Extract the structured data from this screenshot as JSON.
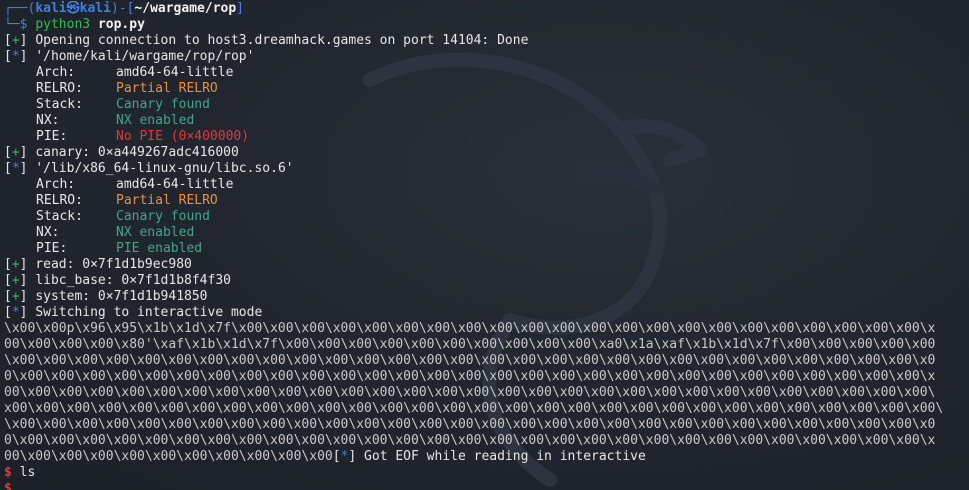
{
  "prompt": {
    "user_host": "kali㉿kali",
    "path": "~/wargame/rop",
    "command_name": "python3",
    "command_arg": "rop.py"
  },
  "log": {
    "opening": "Opening connection to host3.dreamhack.games on port 14104: Done",
    "binary_path": "'/home/kali/wargame/rop/rop'",
    "canary": "canary: 0×a449267adc416000",
    "libc_path": "'/lib/x86_64-linux-gnu/libc.so.6'",
    "read": "read: 0×7f1d1b9ec980",
    "libc_base": "libc_base: 0×7f1d1b8f4f30",
    "system": "system: 0×7f1d1b941850",
    "interactive": "Switching to interactive mode",
    "eof": "Got EOF while reading in interactive"
  },
  "checksec_rop": {
    "arch_key": "Arch:",
    "arch_val": "amd64-64-little",
    "relro_key": "RELRO:",
    "relro_val": "Partial RELRO",
    "stack_key": "Stack:",
    "stack_val": "Canary found",
    "nx_key": "NX:",
    "nx_val": "NX enabled",
    "pie_key": "PIE:",
    "pie_val": "No PIE (0×400000)"
  },
  "checksec_libc": {
    "arch_key": "Arch:",
    "arch_val": "amd64-64-little",
    "relro_key": "RELRO:",
    "relro_val": "Partial RELRO",
    "stack_key": "Stack:",
    "stack_val": "Canary found",
    "nx_key": "NX:",
    "nx_val": "NX enabled",
    "pie_key": "PIE:",
    "pie_val": "PIE enabled"
  },
  "markers": {
    "plus": "+",
    "star": "*",
    "open": "[",
    "close": "]"
  },
  "dump": {
    "line1": "\\x00\\x00p\\x96\\x95\\x1b\\x1d\\x7f\\x00\\x00\\x00\\x00\\x00\\x00\\x00\\x00\\x00\\x00\\x00\\x00\\x00\\x00\\x00\\x00\\x00\\x00\\x00\\x00\\x00\\x00\\x",
    "line2": "00\\x00\\x00\\x00\\x80'\\xaf\\x1b\\x1d\\x7f\\x00\\x00\\x00\\x00\\x00\\x00\\x00\\x00\\x00\\x00\\xa0\\x1a\\xaf\\x1b\\x1d\\x7f\\x00\\x00\\x00\\x00\\x00",
    "line3": "\\x00\\x00\\x00\\x00\\x00\\x00\\x00\\x00\\x00\\x00\\x00\\x00\\x00\\x00\\x00\\x00\\x00\\x00\\x00\\x00\\x00\\x00\\x00\\x00\\x00\\x00\\x00\\x00\\x00\\x0",
    "line4": "0\\x00\\x00\\x00\\x00\\x00\\x00\\x00\\x00\\x00\\x00\\x00\\x00\\x00\\x00\\x00\\x00\\x00\\x00\\x00\\x00\\x00\\x00\\x00\\x00\\x00\\x00\\x00\\x00\\x00\\x",
    "line5": "00\\x00\\x00\\x00\\x00\\x00\\x00\\x00\\x00\\x00\\x00\\x00\\x00\\x00\\x00\\x00\\x00\\x00\\x00\\x00\\x00\\x00\\x00\\x00\\x00\\x00\\x00\\x00\\x00\\x00\\",
    "line6": "x00\\x00\\x00\\x00\\x00\\x00\\x00\\x00\\x00\\x00\\x00\\x00\\x00\\x00\\x00\\x00\\x00\\x00\\x00\\x00\\x00\\x00\\x00\\x00\\x00\\x00\\x00\\x00\\x00\\x00\\",
    "line7": "\\x00\\x00\\x00\\x00\\x00\\x00\\x00\\x00\\x00\\x00\\x00\\x00\\x00\\x00\\x00\\x00\\x00\\x00\\x00\\x00\\x00\\x00\\x00\\x00\\x00\\x00\\x00\\x00\\x00\\x0",
    "line8": "0\\x00\\x00\\x00\\x00\\x00\\x00\\x00\\x00\\x00\\x00\\x00\\x00\\x00\\x00\\x00\\x00\\x00\\x00\\x00\\x00\\x00\\x00\\x00\\x00\\x00\\x00\\x00\\x00\\x00\\x",
    "line9": "00\\x00\\x00\\x00\\x00\\x00\\x00\\x00\\x00\\x00\\x00"
  },
  "shell": {
    "dollar": "$",
    "cmd": "ls"
  },
  "colors": {
    "background": "#1f232b",
    "prompt_blue": "#3f7fe8",
    "success_green": "#2fbf4f",
    "warning_orange": "#e8913a",
    "ok_teal": "#3fa68c",
    "error_red": "#e5353b"
  }
}
